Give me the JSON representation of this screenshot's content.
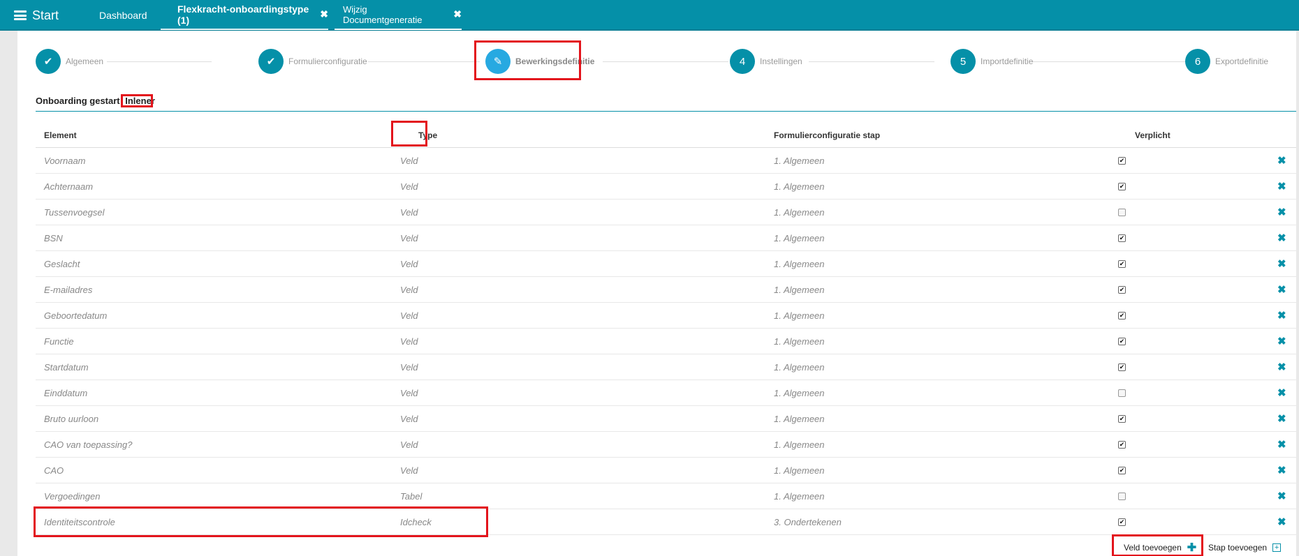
{
  "topbar": {
    "start_label": "Start",
    "tabs": [
      {
        "label": "Dashboard"
      },
      {
        "label": "Flexkracht-onboardingstype (1)",
        "close": "✖"
      },
      {
        "label": "Wijzig Documentgeneratie",
        "close": "✖"
      }
    ]
  },
  "wizard": {
    "steps": [
      {
        "label": "Algemeen",
        "marker": "✔",
        "state": "done"
      },
      {
        "label": "Formulierconfiguratie",
        "marker": "✔",
        "state": "done"
      },
      {
        "label": "Bewerkingsdefinitie",
        "marker": "✎",
        "state": "active"
      },
      {
        "label": "Instellingen",
        "marker": "4",
        "state": "todo"
      },
      {
        "label": "Importdefinitie",
        "marker": "5",
        "state": "todo"
      },
      {
        "label": "Exportdefinitie",
        "marker": "6",
        "state": "todo"
      }
    ]
  },
  "section": {
    "title": "Onboarding gestart",
    "tag": "Inlener"
  },
  "table": {
    "headers": [
      "Element",
      "Type",
      "Formulierconfiguratie stap",
      "Verplicht"
    ],
    "rows": [
      {
        "element": "Voornaam",
        "type": "Veld",
        "stap": "1. Algemeen",
        "verplicht": true
      },
      {
        "element": "Achternaam",
        "type": "Veld",
        "stap": "1. Algemeen",
        "verplicht": true
      },
      {
        "element": "Tussenvoegsel",
        "type": "Veld",
        "stap": "1. Algemeen",
        "verplicht": false
      },
      {
        "element": "BSN",
        "type": "Veld",
        "stap": "1. Algemeen",
        "verplicht": true
      },
      {
        "element": "Geslacht",
        "type": "Veld",
        "stap": "1. Algemeen",
        "verplicht": true
      },
      {
        "element": "E-mailadres",
        "type": "Veld",
        "stap": "1. Algemeen",
        "verplicht": true
      },
      {
        "element": "Geboortedatum",
        "type": "Veld",
        "stap": "1. Algemeen",
        "verplicht": true
      },
      {
        "element": "Functie",
        "type": "Veld",
        "stap": "1. Algemeen",
        "verplicht": true
      },
      {
        "element": "Startdatum",
        "type": "Veld",
        "stap": "1. Algemeen",
        "verplicht": true
      },
      {
        "element": "Einddatum",
        "type": "Veld",
        "stap": "1. Algemeen",
        "verplicht": false
      },
      {
        "element": "Bruto uurloon",
        "type": "Veld",
        "stap": "1. Algemeen",
        "verplicht": true
      },
      {
        "element": "CAO van toepassing?",
        "type": "Veld",
        "stap": "1. Algemeen",
        "verplicht": true
      },
      {
        "element": "CAO",
        "type": "Veld",
        "stap": "1. Algemeen",
        "verplicht": true
      },
      {
        "element": "Vergoedingen",
        "type": "Tabel",
        "stap": "1. Algemeen",
        "verplicht": false
      },
      {
        "element": "Identiteitscontrole",
        "type": "Idcheck",
        "stap": "3. Ondertekenen",
        "verplicht": true
      }
    ]
  },
  "actions": {
    "add_field": "Veld toevoegen",
    "add_step": "Stap toevoegen"
  },
  "icons": {
    "delete": "✖",
    "check": "✔",
    "plus": "✚",
    "plus_box": "+"
  },
  "colors": {
    "brand": "#0590a8",
    "active_step": "#27a9e1",
    "highlight": "#e3141c"
  }
}
